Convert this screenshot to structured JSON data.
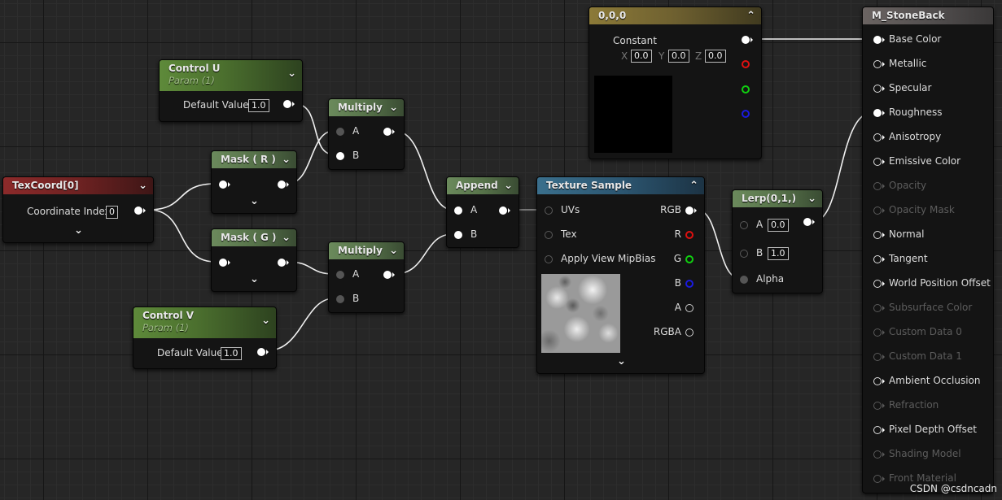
{
  "nodes": {
    "control_u": {
      "title": "Control U",
      "subtitle": "Param (1)",
      "label": "Default Value",
      "value": "1.0"
    },
    "control_v": {
      "title": "Control V",
      "subtitle": "Param (1)",
      "label": "Default Value",
      "value": "1.0"
    },
    "texcoord": {
      "title": "TexCoord[0]",
      "label": "Coordinate Index",
      "value": "0"
    },
    "mask_r": {
      "title": "Mask ( R )"
    },
    "mask_g": {
      "title": "Mask ( G )"
    },
    "multiply_1": {
      "title": "Multiply",
      "pin_a": "A",
      "pin_b": "B"
    },
    "multiply_2": {
      "title": "Multiply",
      "pin_a": "A",
      "pin_b": "B"
    },
    "append": {
      "title": "Append",
      "pin_a": "A",
      "pin_b": "B"
    },
    "texture_sample": {
      "title": "Texture Sample",
      "inputs": [
        "UVs",
        "Tex",
        "Apply View MipBias"
      ],
      "outputs": [
        "RGB",
        "R",
        "G",
        "B",
        "A",
        "RGBA"
      ]
    },
    "constant": {
      "title": "0,0,0",
      "label": "Constant",
      "x_label": "X",
      "x": "0.0",
      "y_label": "Y",
      "y": "0.0",
      "z_label": "Z",
      "z": "0.0"
    },
    "lerp": {
      "title": "Lerp(0,1,)",
      "pin_a": "A",
      "a_value": "0.0",
      "pin_b": "B",
      "b_value": "1.0",
      "pin_alpha": "Alpha"
    },
    "material": {
      "title": "M_StoneBack",
      "pins": [
        {
          "label": "Base Color",
          "state": "connected"
        },
        {
          "label": "Metallic",
          "state": "enabled"
        },
        {
          "label": "Specular",
          "state": "enabled"
        },
        {
          "label": "Roughness",
          "state": "connected"
        },
        {
          "label": "Anisotropy",
          "state": "enabled"
        },
        {
          "label": "Emissive Color",
          "state": "enabled"
        },
        {
          "label": "Opacity",
          "state": "disabled"
        },
        {
          "label": "Opacity Mask",
          "state": "disabled"
        },
        {
          "label": "Normal",
          "state": "enabled"
        },
        {
          "label": "Tangent",
          "state": "enabled"
        },
        {
          "label": "World Position Offset",
          "state": "enabled"
        },
        {
          "label": "Subsurface Color",
          "state": "disabled"
        },
        {
          "label": "Custom Data 0",
          "state": "disabled"
        },
        {
          "label": "Custom Data 1",
          "state": "disabled"
        },
        {
          "label": "Ambient Occlusion",
          "state": "enabled"
        },
        {
          "label": "Refraction",
          "state": "disabled"
        },
        {
          "label": "Pixel Depth Offset",
          "state": "enabled"
        },
        {
          "label": "Shading Model",
          "state": "disabled"
        },
        {
          "label": "Front Material",
          "state": "disabled"
        }
      ]
    }
  },
  "watermark": "CSDN @csdncadn",
  "icons": {
    "collapse": "chevron-down-icon",
    "expand": "chevron-up-icon"
  }
}
